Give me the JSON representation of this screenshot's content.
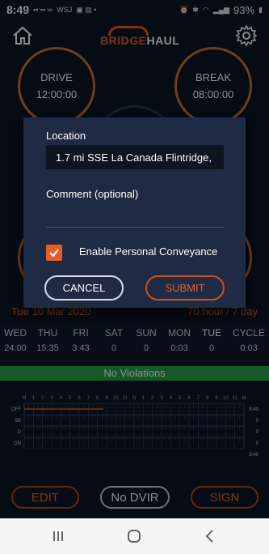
{
  "status_bar": {
    "time": "8:49",
    "notifications": "WSJ",
    "battery": "93%"
  },
  "header": {
    "logo_part1": "BRIDGE",
    "logo_part2": "HAUL"
  },
  "gauges": {
    "drive": {
      "label": "DRIVE",
      "value": "12:00:00"
    },
    "break": {
      "label": "BREAK",
      "value": "08:00:00"
    }
  },
  "date_bar": {
    "left": "Tue 10 Mar 2020",
    "right": "70 hour / 7 day"
  },
  "days": [
    {
      "name": "WED",
      "value": "24:00"
    },
    {
      "name": "THU",
      "value": "15:35"
    },
    {
      "name": "FRI",
      "value": "3:43"
    },
    {
      "name": "SAT",
      "value": "0"
    },
    {
      "name": "SUN",
      "value": "0"
    },
    {
      "name": "MON",
      "value": "0:03"
    },
    {
      "name": "TUE",
      "value": "0"
    },
    {
      "name": "CYCLE",
      "value": "0:03"
    }
  ],
  "violations": "No Violations",
  "log_grid": {
    "rows": [
      "OFF",
      "SB",
      "D",
      "ON"
    ],
    "totals": [
      "8:40",
      "0",
      "0",
      "0"
    ],
    "grand_total": "8:40",
    "hour_labels": [
      "M",
      "1",
      "2",
      "3",
      "4",
      "5",
      "6",
      "7",
      "8",
      "9",
      "10",
      "11",
      "N",
      "1",
      "2",
      "3",
      "4",
      "5",
      "6",
      "7",
      "8",
      "9",
      "10",
      "11",
      "M"
    ]
  },
  "buttons": {
    "edit": "EDIT",
    "dvir": "No DVIR",
    "sign": "SIGN"
  },
  "dialog": {
    "location_label": "Location",
    "location_value": "1.7 mi SSE La Canada Flintridge,",
    "comment_label": "Comment (optional)",
    "checkbox_label": "Enable Personal Conveyance",
    "checkbox_checked": true,
    "cancel": "CANCEL",
    "submit": "SUBMIT"
  },
  "colors": {
    "accent": "#e85d2a",
    "background": "#0c1626",
    "dialog": "#1f2a44",
    "violation_bar": "#27a34a"
  }
}
